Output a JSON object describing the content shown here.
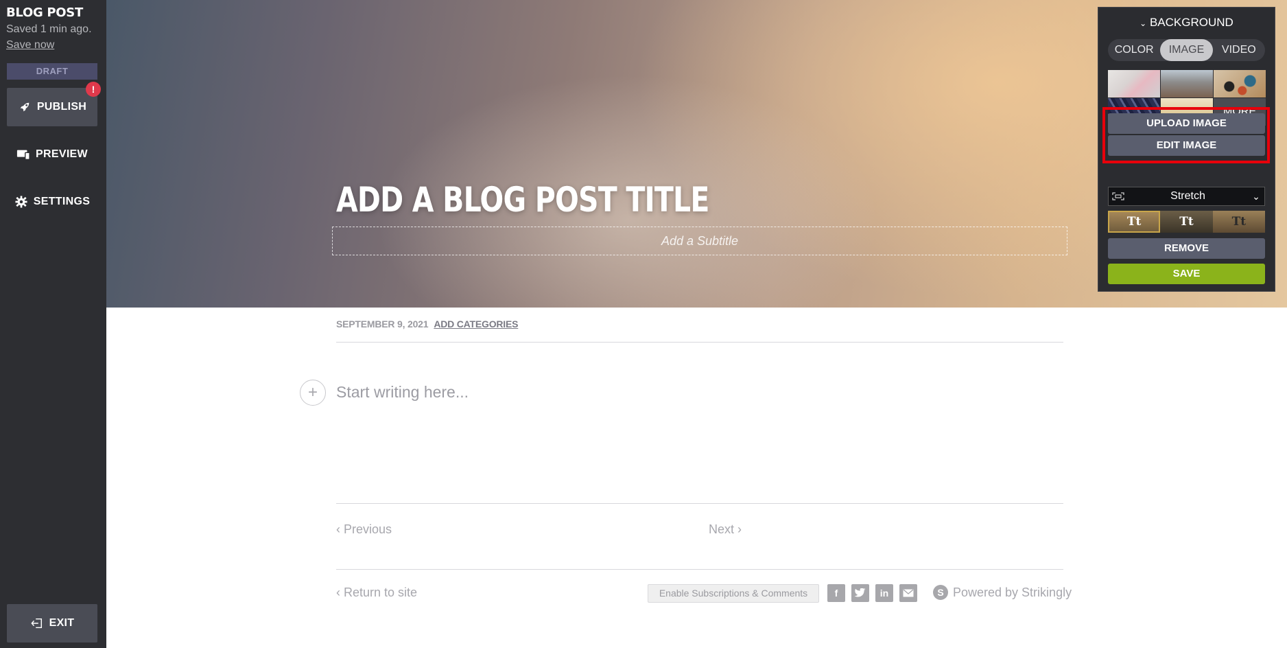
{
  "sidebar": {
    "title": "BLOG POST",
    "saved_text": "Saved 1 min ago.",
    "save_now": "Save now",
    "draft": "DRAFT",
    "publish": "PUBLISH",
    "publish_badge": "!",
    "preview": "PREVIEW",
    "settings": "SETTINGS",
    "exit": "EXIT"
  },
  "hero": {
    "title": "ADD A BLOG POST TITLE",
    "subtitle_placeholder": "Add a Subtitle"
  },
  "post": {
    "date": "SEPTEMBER 9, 2021",
    "categories": "ADD CATEGORIES",
    "body_placeholder": "Start writing here...",
    "previous": "Previous",
    "next": "Next",
    "return": "Return to site",
    "enable_subscriptions": "Enable Subscriptions & Comments",
    "powered_by": "Powered by Strikingly"
  },
  "panel": {
    "heading": "BACKGROUND",
    "tabs": [
      "COLOR",
      "IMAGE",
      "VIDEO"
    ],
    "active_tab": "IMAGE",
    "more": "MORE",
    "upload_image": "UPLOAD IMAGE",
    "edit_image": "EDIT IMAGE",
    "fit_select": "Stretch",
    "text_style_swatches": [
      "Tt",
      "Tt",
      "Tt"
    ],
    "remove": "REMOVE",
    "save": "SAVE"
  },
  "colors": {
    "sidebar_bg": "#2d2e32",
    "save_green": "#8bb31b",
    "highlight_red": "#e8000b",
    "badge_red": "#e0394b"
  }
}
